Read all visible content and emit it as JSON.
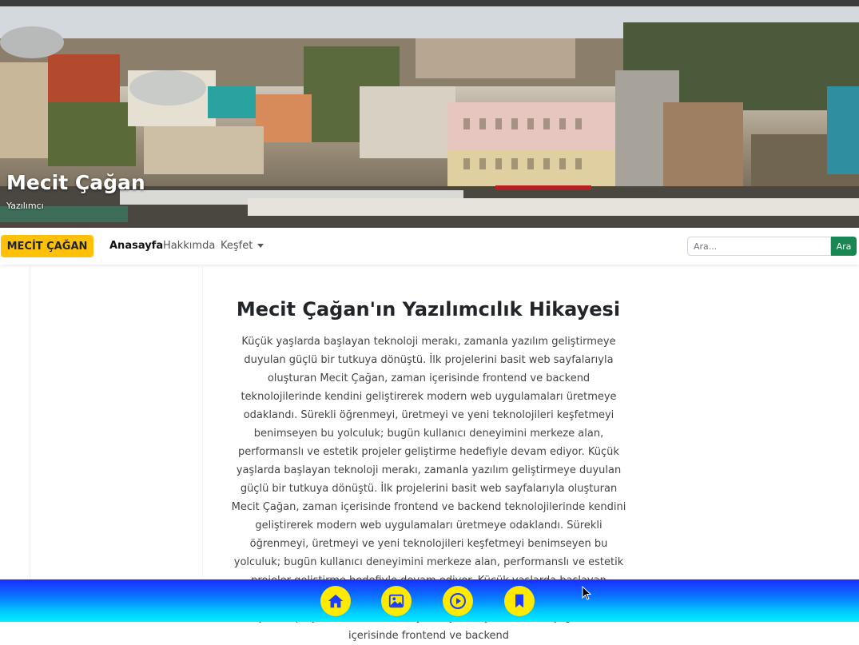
{
  "hero": {
    "title": "Mecit Çağan",
    "subtitle": "Yazılımcı"
  },
  "navbar": {
    "brand": "MECİT ÇAĞAN",
    "links": [
      "Anasayfa",
      "Hakkımda",
      "Keşfet"
    ],
    "search_placeholder": "Ara...",
    "search_button": "Ara"
  },
  "article": {
    "title": "Mecit Çağan'ın Yazılımcılık Hikayesi",
    "body": "Küçük yaşlarda başlayan teknoloji merakı, zamanla yazılım geliştirmeye duyulan güçlü bir tutkuya dönüştü. İlk projelerini basit web sayfalarıyla oluşturan Mecit Çağan, zaman içerisinde frontend ve backend teknolojilerinde kendini geliştirerek modern web uygulamaları üretmeye odaklandı. Sürekli öğrenmeyi, üretmeyi ve yeni teknolojileri keşfetmeyi benimseyen bu yolculuk; bugün kullanıcı deneyimini merkeze alan, performanslı ve estetik projeler geliştirme hedefiyle devam ediyor. Küçük yaşlarda başlayan teknoloji merakı, zamanla yazılım geliştirmeye duyulan güçlü bir tutkuya dönüştü. İlk projelerini basit web sayfalarıyla oluşturan Mecit Çağan, zaman içerisinde frontend ve backend teknolojilerinde kendini geliştirerek modern web uygulamaları üretmeye odaklandı. Sürekli öğrenmeyi, üretmeyi ve yeni teknolojileri keşfetmeyi benimseyen bu yolculuk; bugün kullanıcı deneyimini merkeze alan, performanslı ve estetik projeler geliştirme hedefiyle devam ediyor. Küçük yaşlarda başlayan teknoloji merakı, zamanla yazılım geliştirmeye duyulan güçlü bir tutkuya dönüştü. İlk projelerini basit web sayfalarıyla oluşturan Mecit Çağan, zaman içerisinde frontend ve backend"
  },
  "bottom_bar": {
    "buttons": [
      "home-icon",
      "image-icon",
      "play-icon",
      "bookmark-icon"
    ]
  },
  "colors": {
    "brand": "#ffc107",
    "search_button": "#198754",
    "bottom_bar_top": "#1a2bff",
    "bottom_bar_bottom": "#00f0ff",
    "icon_button": "#ffea00",
    "icon_glyph": "#1a3cff"
  }
}
